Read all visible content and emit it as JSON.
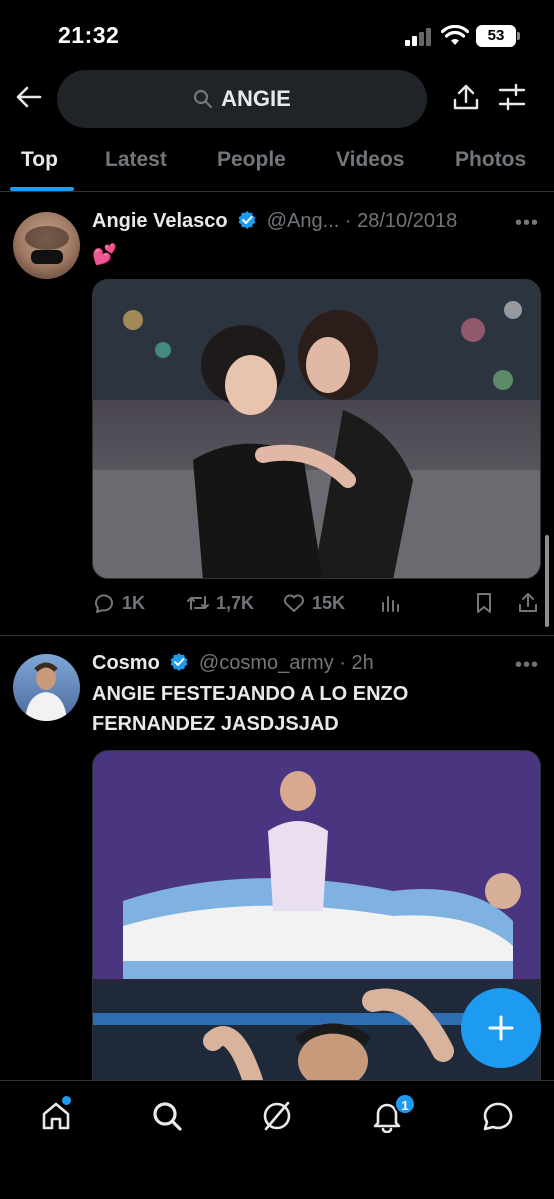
{
  "status_bar": {
    "time": "21:32",
    "battery": "53"
  },
  "search": {
    "query": "ANGIE"
  },
  "tabs": [
    {
      "label": "Top",
      "active": true
    },
    {
      "label": "Latest",
      "active": false
    },
    {
      "label": "People",
      "active": false
    },
    {
      "label": "Videos",
      "active": false
    },
    {
      "label": "Photos",
      "active": false
    }
  ],
  "tweets": [
    {
      "name": "Angie Velasco",
      "handle": "@Ang...",
      "time": "28/10/2018",
      "text": "💕",
      "replies": "1K",
      "reposts": "1,7K",
      "likes": "15K"
    },
    {
      "name": "Cosmo",
      "handle": "@cosmo_army",
      "time": "2h",
      "text": "ANGIE FESTEJANDO A LO ENZO FERNANDEZ JASDJSJAD"
    }
  ],
  "bottom_nav": {
    "notifications_count": "1"
  },
  "colors": {
    "accent": "#1d9bf0",
    "muted": "#71767b",
    "background": "#000000",
    "search_bg": "#202327"
  }
}
